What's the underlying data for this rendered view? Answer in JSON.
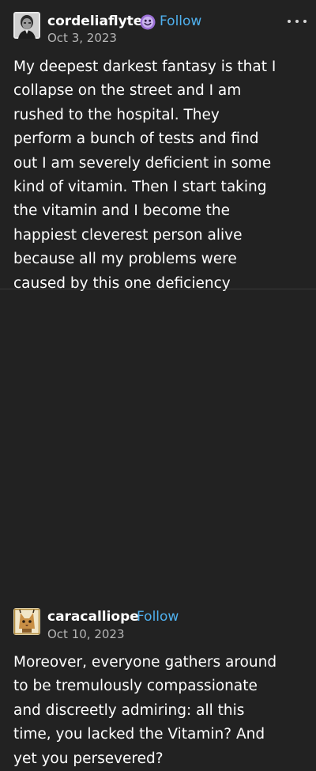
{
  "posts": [
    {
      "username": "cordeliaflyte",
      "follow_label": "Follow",
      "date": "Oct 3, 2023",
      "badge_icon": "purple-smiley-badge-icon",
      "more_icon": "ellipsis-icon",
      "body_lines": [
        "My deepest darkest fantasy is that I",
        "collapse on the street and I am",
        "rushed to the hospital. They",
        "perform a bunch of tests and find",
        "out I am severely deficient in some",
        "kind of vitamin. Then I start taking",
        "the vitamin and I become the",
        "happiest cleverest person alive",
        "because all my problems were",
        "caused by this one deficiency"
      ]
    },
    {
      "username": "caracalliope",
      "follow_label": "Follow",
      "date": "Oct 10, 2023",
      "body_lines": [
        "Moreover, everyone gathers around",
        "to be tremulously compassionate",
        "and discreetly admiring: all this",
        "time, you lacked the Vitamin? And",
        "yet you persevered?"
      ]
    }
  ],
  "colors": {
    "background": "#222222",
    "text": "#ffffff",
    "follow": "#4fb0ee",
    "date": "#b6b6b6",
    "badge": "#9b6fd6"
  }
}
